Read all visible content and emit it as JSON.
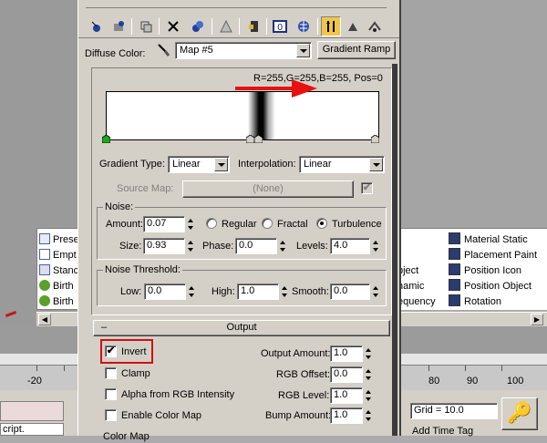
{
  "background": {
    "left_list": [
      {
        "label": "Prese",
        "icon": "preset-icon"
      },
      {
        "label": "Empt",
        "icon": "empty-icon"
      },
      {
        "label": "Stanc",
        "icon": "standard-icon"
      },
      {
        "label": "Birth",
        "icon": "birth-icon"
      },
      {
        "label": "Birth",
        "icon": "birth-icon"
      }
    ],
    "right_cut": [
      "bject",
      "namic",
      "equency"
    ],
    "right_list": [
      {
        "label": "Material Static",
        "icon": "material-static-icon"
      },
      {
        "label": "Placement Paint",
        "icon": "placement-paint-icon"
      },
      {
        "label": "Position Icon",
        "icon": "position-icon-icon"
      },
      {
        "label": "Position Object",
        "icon": "position-object-icon"
      },
      {
        "label": "Rotation",
        "icon": "rotation-icon"
      }
    ],
    "ruler_labels": [
      "-20",
      "80",
      "90",
      "100"
    ],
    "status": {
      "script_text": "cript.",
      "grid": "Grid = 10.0",
      "time_tag": "Add Time Tag"
    }
  },
  "editor": {
    "diffuse_label": "Diffuse Color:",
    "map_name": "Map #5",
    "gradient_ramp_button": "Gradient Ramp",
    "readout": "R=255,G=255,B=255, Pos=0",
    "gradient_type_label": "Gradient Type:",
    "gradient_type_value": "Linear",
    "interpolation_label": "Interpolation:",
    "interpolation_value": "Linear",
    "source_map_label": "Source Map:",
    "source_map_value": "(None)",
    "noise": {
      "title": "Noise:",
      "amount_label": "Amount:",
      "amount": "0.07",
      "size_label": "Size:",
      "size": "0.93",
      "phase_label": "Phase:",
      "phase": "0.0",
      "levels_label": "Levels:",
      "levels": "4.0",
      "radio_regular": "Regular",
      "radio_fractal": "Fractal",
      "radio_turbulence": "Turbulence",
      "selected": "Turbulence"
    },
    "threshold": {
      "title": "Noise Threshold:",
      "low_label": "Low:",
      "low": "0.0",
      "high_label": "High:",
      "high": "1.0",
      "smooth_label": "Smooth:",
      "smooth": "0.0"
    },
    "output": {
      "header": "Output",
      "collapse_symbol": "–",
      "invert_label": "Invert",
      "invert_checked": true,
      "clamp_label": "Clamp",
      "alpha_label": "Alpha from RGB Intensity",
      "color_map_label": "Enable Color Map",
      "color_map_partial": "Color Map",
      "output_amount_label": "Output Amount:",
      "output_amount": "1.0",
      "rgb_offset_label": "RGB Offset:",
      "rgb_offset": "0.0",
      "rgb_level_label": "RGB Level:",
      "rgb_level": "1.0",
      "bump_amount_label": "Bump Amount:",
      "bump_amount": "1.0"
    },
    "check_mark": "✔"
  },
  "colors": {
    "panel": "#d4d0c8",
    "highlight_red": "#d01010",
    "arrow_red": "#e81010",
    "flag_green": "#1aa81a",
    "pressed_button": "#f0c64a"
  }
}
